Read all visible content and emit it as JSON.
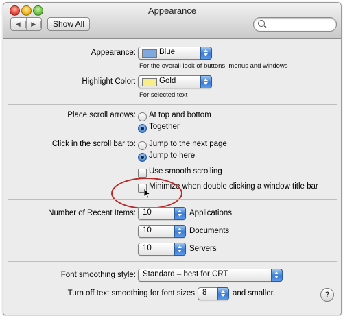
{
  "window": {
    "title": "Appearance"
  },
  "toolbar": {
    "back_icon": "left-arrow",
    "forward_icon": "right-arrow",
    "show_all_label": "Show All",
    "search_value": "",
    "search_placeholder": ""
  },
  "appearance": {
    "label": "Appearance:",
    "value": "Blue",
    "swatch_color": "#7fa8dd",
    "note": "For the overall look of buttons, menus and windows"
  },
  "highlight": {
    "label": "Highlight Color:",
    "value": "Gold",
    "swatch_color": "#f6ee8a",
    "note": "For selected text"
  },
  "scroll_arrows": {
    "label": "Place scroll arrows:",
    "options": [
      "At top and bottom",
      "Together"
    ],
    "selected": 1
  },
  "scroll_click": {
    "label": "Click in the scroll bar to:",
    "options": [
      "Jump to the next page",
      "Jump to here"
    ],
    "selected": 1
  },
  "checkboxes": [
    {
      "label": "Use smooth scrolling",
      "checked": false
    },
    {
      "label": "Minimize when double clicking a window title bar",
      "checked": false
    }
  ],
  "recent": {
    "label": "Number of Recent Items:",
    "rows": [
      {
        "value": "10",
        "suffix": "Applications"
      },
      {
        "value": "10",
        "suffix": "Documents"
      },
      {
        "value": "10",
        "suffix": "Servers"
      }
    ]
  },
  "font_smoothing": {
    "label": "Font smoothing style:",
    "value": "Standard – best for CRT"
  },
  "text_smoothing": {
    "label": "Turn off text smoothing for font sizes",
    "value": "8",
    "suffix": "and smaller."
  },
  "help": {
    "label": "?"
  },
  "annotation": {
    "color": "#b62a2a"
  }
}
